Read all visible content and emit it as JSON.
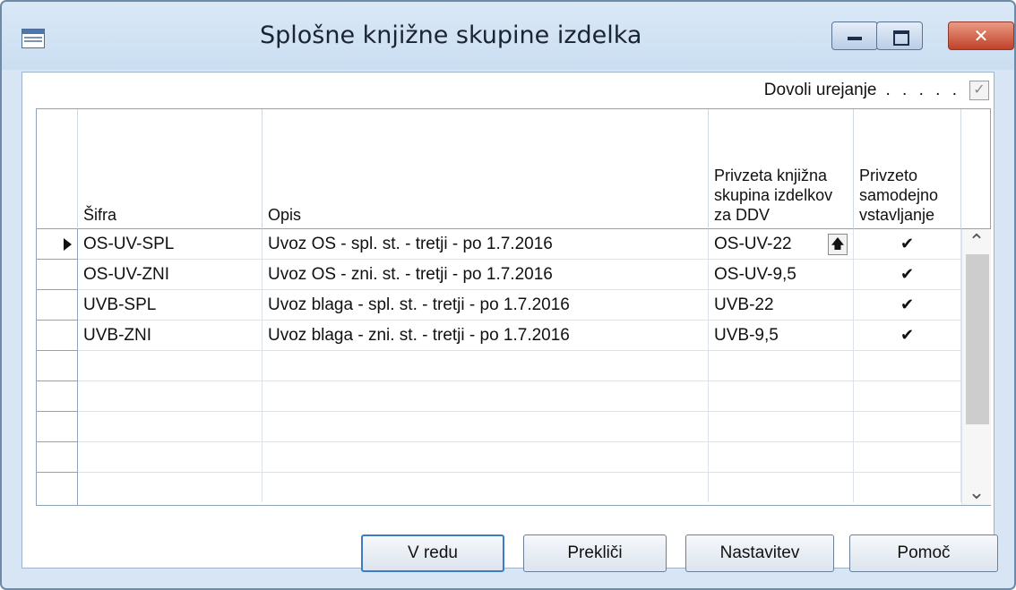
{
  "window": {
    "title": "Splošne knjižne skupine izdelka",
    "minimize_glyph": "",
    "close_glyph": "✕"
  },
  "allow_edit": {
    "label": "Dovoli urejanje",
    "dots": ". . . . .",
    "checked_glyph": "✓"
  },
  "grid": {
    "columns": {
      "code": "Šifra",
      "description": "Opis",
      "vat_group": "Privzeta knjižna skupina izdelkov za DDV",
      "auto_insert": "Privzeto samodejno vstavljanje"
    },
    "rows": [
      {
        "code": "OS-UV-SPL",
        "description": "Uvoz OS - spl. st. - tretji - po 1.7.2016",
        "vat_group": "OS-UV-22",
        "auto_insert": "✔"
      },
      {
        "code": "OS-UV-ZNI",
        "description": "Uvoz OS - zni. st. - tretji - po 1.7.2016",
        "vat_group": "OS-UV-9,5",
        "auto_insert": "✔"
      },
      {
        "code": "UVB-SPL",
        "description": "Uvoz blaga - spl. st. - tretji - po 1.7.2016",
        "vat_group": "UVB-22",
        "auto_insert": "✔"
      },
      {
        "code": "UVB-ZNI",
        "description": "Uvoz blaga - zni. st. - tretji - po 1.7.2016",
        "vat_group": "UVB-9,5",
        "auto_insert": "✔"
      }
    ],
    "lookup_glyph": "🡅",
    "scroll_up_glyph": "⌃",
    "scroll_down_glyph": "⌄"
  },
  "buttons": {
    "ok": "V redu",
    "cancel": "Prekliči",
    "setup": "Nastavitev",
    "help": "Pomoč"
  }
}
